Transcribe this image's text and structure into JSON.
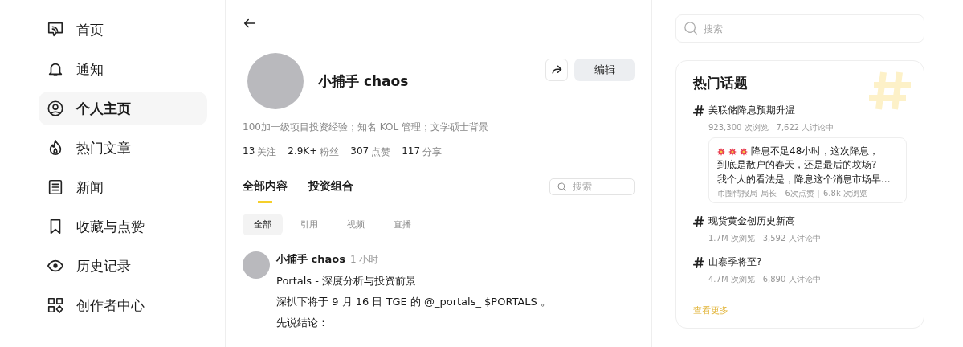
{
  "sidebar": {
    "items": [
      {
        "label": "首页",
        "selected": false
      },
      {
        "label": "通知",
        "selected": false
      },
      {
        "label": "个人主页",
        "selected": true
      },
      {
        "label": "热门文章",
        "selected": false
      },
      {
        "label": "新闻",
        "selected": false
      },
      {
        "label": "收藏与点赞",
        "selected": false
      },
      {
        "label": "历史记录",
        "selected": false
      },
      {
        "label": "创作者中心",
        "selected": false
      }
    ]
  },
  "profile": {
    "name": "小捕手 chaos",
    "edit_button": "编辑",
    "bio": "100加一级项目投资经验；知名 KOL 管理；文学硕士背景",
    "stats": [
      {
        "count": "13",
        "unit": "关注"
      },
      {
        "count": "2.9K+",
        "unit": "粉丝"
      },
      {
        "count": "307",
        "unit": "点赞"
      },
      {
        "count": "117",
        "unit": "分享"
      }
    ]
  },
  "tabs": [
    {
      "label": "全部内容",
      "selected": true
    },
    {
      "label": "投资组合",
      "selected": false
    }
  ],
  "content_search": {
    "placeholder": "搜索"
  },
  "filters": [
    {
      "label": "全部",
      "selected": true
    },
    {
      "label": "引用",
      "selected": false
    },
    {
      "label": "视频",
      "selected": false
    },
    {
      "label": "直播",
      "selected": false
    }
  ],
  "post": {
    "author": "小捕手 chaos",
    "time": "1 小时",
    "title": "Portals - 深度分析与投资前景",
    "paragraphs": [
      "深扒下将于 9 月 16 日 TGE 的 @_portals_ $PORTALS 。",
      "先说结论："
    ]
  },
  "search": {
    "placeholder": "搜索"
  },
  "trending": {
    "title": "热门话题",
    "topics": [
      {
        "name": "美联储降息预期升温",
        "views": "923,300 次浏览",
        "discussing": "7,622 人讨论中",
        "featured": {
          "lines": [
            "降息不足48小时，这次降息，",
            "到底是散户的春天，还是最后的坟场?",
            "我个人的看法是，降息这个消息市场早..."
          ],
          "author": "币圈情报局-局长",
          "likes": "6次点赞",
          "views": "6.8k 次浏览"
        }
      },
      {
        "name": "现货黄金创历史新高",
        "views": "1.7M 次浏览",
        "discussing": "3,592 人讨论中"
      },
      {
        "name": "山寨季将至?",
        "views": "4.7M 次浏览",
        "discussing": "6,890 人讨论中"
      }
    ],
    "more": "查看更多"
  }
}
